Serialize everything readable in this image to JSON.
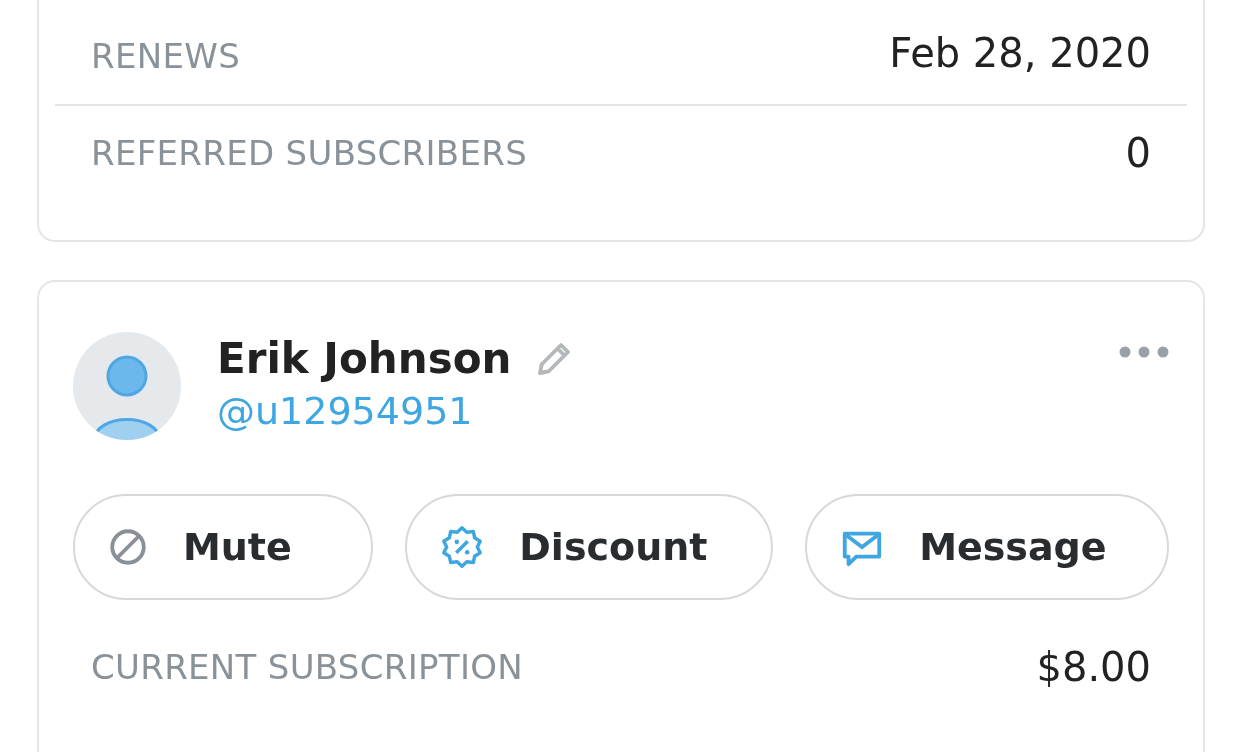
{
  "summary_card": {
    "rows": [
      {
        "label": "RENEWS",
        "value": "Feb 28, 2020"
      },
      {
        "label": "REFERRED SUBSCRIBERS",
        "value": "0"
      }
    ]
  },
  "subscriber_card": {
    "name": "Erik Johnson",
    "username": "@u12954951",
    "actions": [
      {
        "kind": "mute",
        "label": "Mute"
      },
      {
        "kind": "discount",
        "label": "Discount"
      },
      {
        "kind": "message",
        "label": "Message"
      }
    ],
    "rows": [
      {
        "label": "CURRENT SUBSCRIPTION",
        "value": "$8.00"
      }
    ]
  }
}
